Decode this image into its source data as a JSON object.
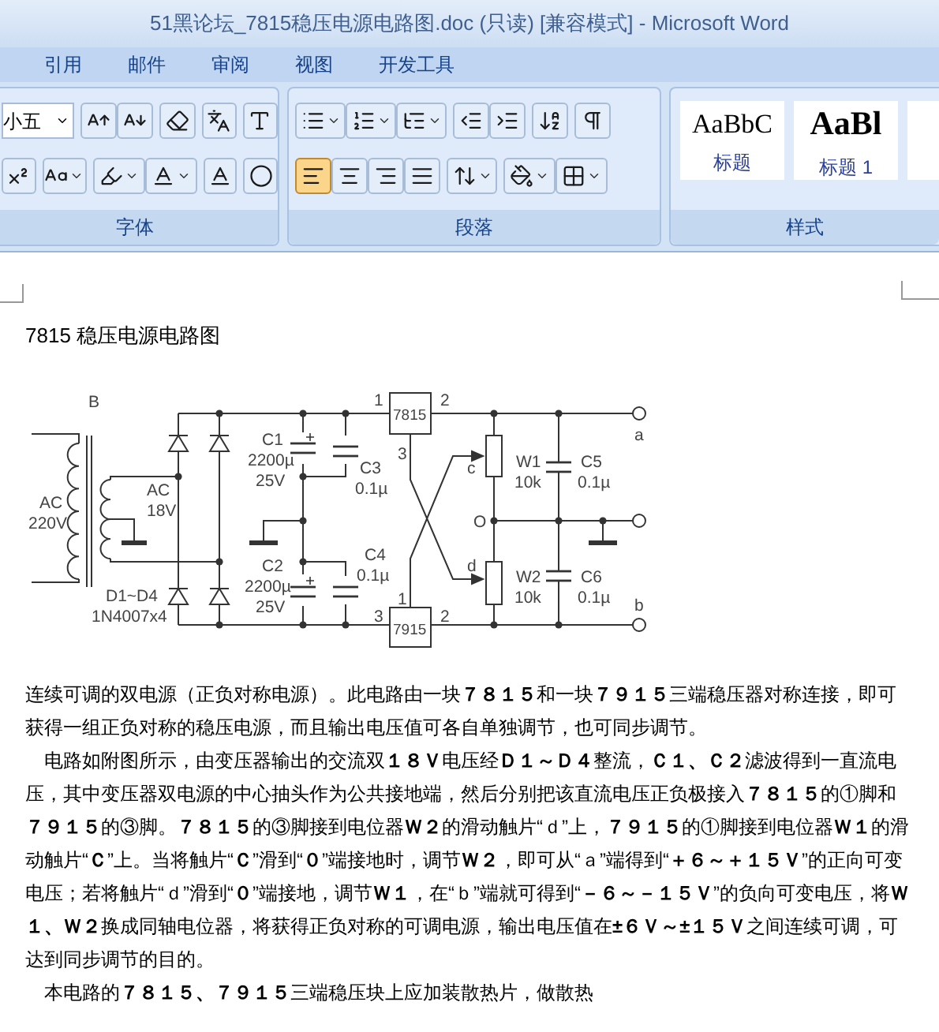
{
  "window": {
    "title": "51黑论坛_7815稳压电源电路图.doc (只读) [兼容模式] - Microsoft Word"
  },
  "tabs": [
    {
      "label": "引用",
      "selected": false
    },
    {
      "label": "邮件",
      "selected": false
    },
    {
      "label": "审阅",
      "selected": false
    },
    {
      "label": "视图",
      "selected": false
    },
    {
      "label": "开发工具",
      "selected": false
    }
  ],
  "ribbon": {
    "font_group": {
      "label": "字体",
      "font_size": "小五"
    },
    "paragraph_group": {
      "label": "段落",
      "alignment": [
        {
          "kind": "left",
          "selected": true
        },
        {
          "kind": "center",
          "selected": false
        },
        {
          "kind": "right",
          "selected": false
        },
        {
          "kind": "justify",
          "selected": false
        }
      ]
    },
    "styles_group": {
      "label": "样式",
      "styles": [
        {
          "preview": "AaBbC",
          "name": "标题",
          "selected": false
        },
        {
          "preview": "AaBl",
          "name": "标题 1",
          "selected": false
        }
      ]
    }
  },
  "document": {
    "title": "7815 稳压电源电路图",
    "schematic": {
      "labels": [
        "B",
        "1",
        "2",
        "7815",
        "a",
        "C1",
        "3",
        "2200µ",
        "C3",
        "c",
        "W1",
        "C5",
        "AC",
        "25V",
        "0.1µ",
        "10k",
        "0.1µ",
        "AC",
        "18V",
        "220V",
        "O",
        "C2",
        "C4",
        "d",
        "2200µ",
        "0.1µ",
        "W2",
        "C6",
        "D1~D4",
        "25V",
        "1",
        "10k",
        "0.1µ",
        "b",
        "1N4007x4",
        "3",
        "2",
        "7915"
      ]
    },
    "paragraphs": [
      "连续可调的双电源（正负对称电源）。此电路由一块**７８１５**和一块**７９１５**三端稳压器对称连接，即可获得一组正负对称的稳压电源，而且输出电压值可各自单独调节，也可同步调节。",
      "电路如附图所示，由变压器输出的交流双**１８Ｖ**电压经**Ｄ１～Ｄ４**整流，**Ｃ１、Ｃ２**滤波得到一直流电压，其中变压器双电源的中心抽头作为公共接地端，然后分别把该直流电压正负极接入**７８１５**的①脚和**７９１５**的③脚。**７８１５**的③脚接到电位器**Ｗ２**的滑动触片“ｄ”上，**７９１５**的①脚接到电位器**Ｗ１**的滑动触片“**Ｃ**”上。当将触片“**Ｃ**”滑到“**０**”端接地时，调节**Ｗ２**，即可从“ａ”端得到“**＋６～＋１５Ｖ**”的正向可变电压；若将触片“ｄ”滑到“**０**”端接地，调节**Ｗ１**，在“ｂ”端就可得到“**－６～－１５Ｖ**”的负向可变电压，将**Ｗ１、Ｗ２**换成同轴电位器，将获得正负对称的可调电源，输出电压值在**±６Ｖ～±１５Ｖ**之间连续可调，可达到同步调节的目的。",
      "本电路的**７８１５、７９１５**三端稳压块上应加装散热片，做散热"
    ]
  }
}
